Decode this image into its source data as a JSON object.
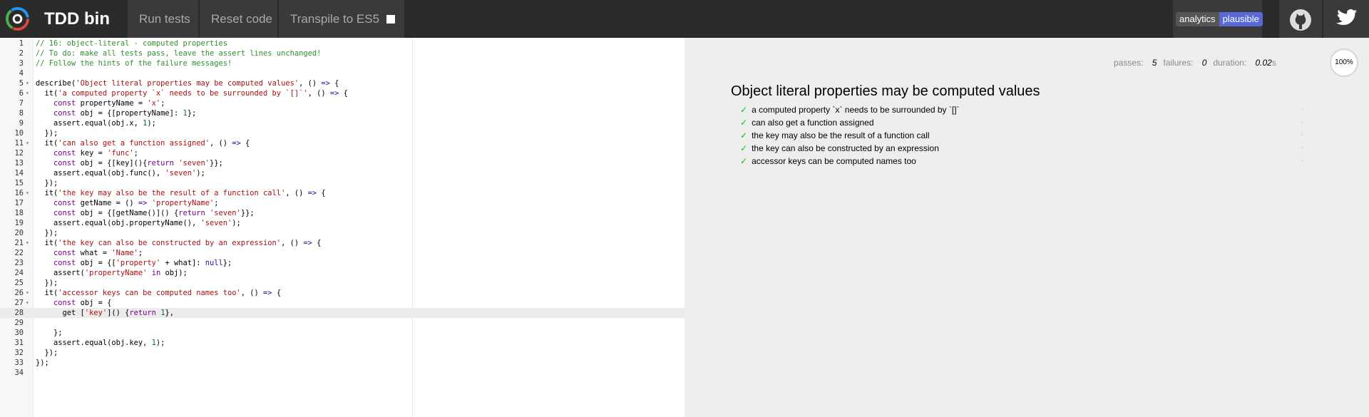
{
  "header": {
    "title": "TDD bin",
    "nav": {
      "run_tests": "Run tests",
      "reset_code": "Reset code",
      "transpile": "Transpile to ES5"
    },
    "analytics_badge": {
      "left": "analytics",
      "right": "plausible"
    },
    "colors": {
      "bar": "#2b2b2b",
      "button": "#3a3a3a",
      "badge_accent": "#5a67d8"
    }
  },
  "editor": {
    "active_line": 28,
    "lines": [
      {
        "n": "1",
        "fold": false
      },
      {
        "n": "2",
        "fold": false
      },
      {
        "n": "3",
        "fold": false
      },
      {
        "n": "4",
        "fold": false
      },
      {
        "n": "5",
        "fold": true
      },
      {
        "n": "6",
        "fold": true
      },
      {
        "n": "7",
        "fold": false
      },
      {
        "n": "8",
        "fold": false
      },
      {
        "n": "9",
        "fold": false
      },
      {
        "n": "10",
        "fold": false
      },
      {
        "n": "11",
        "fold": true
      },
      {
        "n": "12",
        "fold": false
      },
      {
        "n": "13",
        "fold": false
      },
      {
        "n": "14",
        "fold": false
      },
      {
        "n": "15",
        "fold": false
      },
      {
        "n": "16",
        "fold": true
      },
      {
        "n": "17",
        "fold": false
      },
      {
        "n": "18",
        "fold": false
      },
      {
        "n": "19",
        "fold": false
      },
      {
        "n": "20",
        "fold": false
      },
      {
        "n": "21",
        "fold": true
      },
      {
        "n": "22",
        "fold": false
      },
      {
        "n": "23",
        "fold": false
      },
      {
        "n": "24",
        "fold": false
      },
      {
        "n": "25",
        "fold": false
      },
      {
        "n": "26",
        "fold": true
      },
      {
        "n": "27",
        "fold": true
      },
      {
        "n": "28",
        "fold": false
      },
      {
        "n": "29",
        "fold": false
      },
      {
        "n": "30",
        "fold": false
      },
      {
        "n": "31",
        "fold": false
      },
      {
        "n": "32",
        "fold": false
      },
      {
        "n": "33",
        "fold": false
      },
      {
        "n": "34",
        "fold": false
      }
    ],
    "code": [
      [
        [
          "com",
          "// 16: object-literal - computed properties"
        ]
      ],
      [
        [
          "com",
          "// To do: make all tests pass, leave the assert lines unchanged!"
        ]
      ],
      [
        [
          "com",
          "// Follow the hints of the failure messages!"
        ]
      ],
      [],
      [
        [
          "",
          "describe("
        ],
        [
          "str",
          "'Object literal properties may be computed values'"
        ],
        [
          "",
          ", () "
        ],
        [
          "arr",
          "=>"
        ],
        [
          "",
          " {"
        ]
      ],
      [
        [
          "",
          "  it("
        ],
        [
          "str",
          "'a computed property `x` needs to be surrounded by `[]`'"
        ],
        [
          "",
          ", () "
        ],
        [
          "arr",
          "=>"
        ],
        [
          "",
          " {"
        ]
      ],
      [
        [
          "",
          "    "
        ],
        [
          "kw",
          "const"
        ],
        [
          "",
          " propertyName = "
        ],
        [
          "str",
          "'x'"
        ],
        [
          "",
          ";"
        ]
      ],
      [
        [
          "",
          "    "
        ],
        [
          "kw",
          "const"
        ],
        [
          "",
          " obj = {[propertyName]: "
        ],
        [
          "num",
          "1"
        ],
        [
          "",
          "};"
        ]
      ],
      [
        [
          "",
          "    assert.equal(obj.x, "
        ],
        [
          "num",
          "1"
        ],
        [
          "",
          ");"
        ]
      ],
      [
        [
          "",
          "  });"
        ]
      ],
      [
        [
          "",
          "  it("
        ],
        [
          "str",
          "'can also get a function assigned'"
        ],
        [
          "",
          ", () "
        ],
        [
          "arr",
          "=>"
        ],
        [
          "",
          " {"
        ]
      ],
      [
        [
          "",
          "    "
        ],
        [
          "kw",
          "const"
        ],
        [
          "",
          " key = "
        ],
        [
          "str",
          "'func'"
        ],
        [
          "",
          ";"
        ]
      ],
      [
        [
          "",
          "    "
        ],
        [
          "kw",
          "const"
        ],
        [
          "",
          " obj = {[key](){"
        ],
        [
          "kw",
          "return"
        ],
        [
          "",
          " "
        ],
        [
          "str",
          "'seven'"
        ],
        [
          "",
          "}};"
        ]
      ],
      [
        [
          "",
          "    assert.equal(obj.func(), "
        ],
        [
          "str",
          "'seven'"
        ],
        [
          "",
          ");"
        ]
      ],
      [
        [
          "",
          "  });"
        ]
      ],
      [
        [
          "",
          "  it("
        ],
        [
          "str",
          "'the key may also be the result of a function call'"
        ],
        [
          "",
          ", () "
        ],
        [
          "arr",
          "=>"
        ],
        [
          "",
          " {"
        ]
      ],
      [
        [
          "",
          "    "
        ],
        [
          "kw",
          "const"
        ],
        [
          "",
          " getName = () "
        ],
        [
          "arr",
          "=>"
        ],
        [
          "",
          " "
        ],
        [
          "str",
          "'propertyName'"
        ],
        [
          "",
          ";"
        ]
      ],
      [
        [
          "",
          "    "
        ],
        [
          "kw",
          "const"
        ],
        [
          "",
          " obj = {[getName()]() {"
        ],
        [
          "kw",
          "return"
        ],
        [
          "",
          " "
        ],
        [
          "str",
          "'seven'"
        ],
        [
          "",
          "}};"
        ]
      ],
      [
        [
          "",
          "    assert.equal(obj.propertyName(), "
        ],
        [
          "str",
          "'seven'"
        ],
        [
          "",
          ");"
        ]
      ],
      [
        [
          "",
          "  });"
        ]
      ],
      [
        [
          "",
          "  it("
        ],
        [
          "str",
          "'the key can also be constructed by an expression'"
        ],
        [
          "",
          ", () "
        ],
        [
          "arr",
          "=>"
        ],
        [
          "",
          " {"
        ]
      ],
      [
        [
          "",
          "    "
        ],
        [
          "kw",
          "const"
        ],
        [
          "",
          " what = "
        ],
        [
          "str",
          "'Name'"
        ],
        [
          "",
          ";"
        ]
      ],
      [
        [
          "",
          "    "
        ],
        [
          "kw",
          "const"
        ],
        [
          "",
          " obj = {["
        ],
        [
          "str",
          "'property'"
        ],
        [
          "",
          " + what]: "
        ],
        [
          "atom",
          "null"
        ],
        [
          "",
          "};"
        ]
      ],
      [
        [
          "",
          "    assert("
        ],
        [
          "str",
          "'propertyName'"
        ],
        [
          "",
          " "
        ],
        [
          "kw",
          "in"
        ],
        [
          "",
          " obj);"
        ]
      ],
      [
        [
          "",
          "  });"
        ]
      ],
      [
        [
          "",
          "  it("
        ],
        [
          "str",
          "'accessor keys can be computed names too'"
        ],
        [
          "",
          ", () "
        ],
        [
          "arr",
          "=>"
        ],
        [
          "",
          " {"
        ]
      ],
      [
        [
          "",
          "    "
        ],
        [
          "kw",
          "const"
        ],
        [
          "",
          " obj = {"
        ]
      ],
      [
        [
          "",
          "      get ["
        ],
        [
          "str",
          "'key'"
        ],
        [
          "",
          "]() {"
        ],
        [
          "kw",
          "return"
        ],
        [
          "",
          " "
        ],
        [
          "num",
          "1"
        ],
        [
          "",
          "},"
        ]
      ],
      [],
      [
        [
          "",
          "    };"
        ]
      ],
      [
        [
          "",
          "    assert.equal(obj.key, "
        ],
        [
          "num",
          "1"
        ],
        [
          "",
          ");"
        ]
      ],
      [
        [
          "",
          "  });"
        ]
      ],
      [
        [
          "",
          "});"
        ]
      ],
      []
    ]
  },
  "results": {
    "passes_label": "passes:",
    "passes": "5",
    "failures_label": "failures:",
    "failures": "0",
    "duration_label": "duration:",
    "duration": "0.02",
    "duration_unit": "s",
    "progress": "100%",
    "suite_title": "Object literal properties may be computed values",
    "tests": [
      {
        "title": "a computed property `x` needs to be surrounded by `[]`",
        "status": "passed"
      },
      {
        "title": "can also get a function assigned",
        "status": "passed"
      },
      {
        "title": "the key may also be the result of a function call",
        "status": "passed"
      },
      {
        "title": "the key can also be constructed by an expression",
        "status": "passed"
      },
      {
        "title": "accessor keys can be computed names too",
        "status": "passed"
      }
    ],
    "check_glyph": "✓",
    "dash_glyph": "-"
  }
}
